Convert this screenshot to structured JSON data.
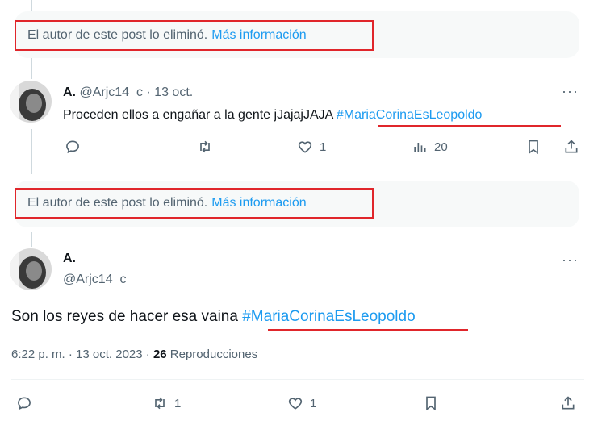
{
  "deleted_notice": {
    "text": "El autor de este post lo eliminó.",
    "link": "Más información"
  },
  "reply_tweet": {
    "display_name": "A.",
    "handle": "@Arjc14_c",
    "separator": "·",
    "date": "13 oct.",
    "text": "Proceden ellos a engañar a la gente jJajajJAJA ",
    "hashtag": "#MariaCorinaEsLeopoldo",
    "more": "···",
    "likes": "1",
    "views": "20"
  },
  "main_tweet": {
    "display_name": "A.",
    "handle": "@Arjc14_c",
    "more": "···",
    "text": "Son los reyes de hacer esa vaina ",
    "hashtag": "#MariaCorinaEsLeopoldo",
    "timestamp": "6:22 p. m. · 13 oct. 2023 · ",
    "view_count": "26",
    "view_label": " Reproducciones",
    "reposts": "1",
    "likes": "1"
  },
  "colors": {
    "accent": "#1d9bf0",
    "highlight": "#e0262b",
    "muted": "#536471"
  }
}
